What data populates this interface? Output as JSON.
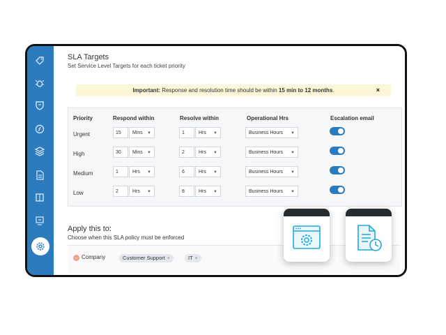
{
  "page": {
    "title": "SLA Targets",
    "subtitle": "Set Service Level Targets for each ticket priority"
  },
  "notice": {
    "label": "Important:",
    "text_before": " Response and resolution time should be within ",
    "range": "15 min to 12 months",
    "text_after": ".",
    "close": "×"
  },
  "table": {
    "headers": {
      "priority": "Priority",
      "respond": "Respond within",
      "resolve": "Resolve within",
      "operational": "Operational Hrs",
      "escalation": "Escalation email"
    },
    "rows": [
      {
        "priority": "Urgent",
        "respond_value": "15",
        "respond_unit": "Mins",
        "resolve_value": "1",
        "resolve_unit": "Hrs",
        "operational": "Business Hours",
        "escalation_on": true
      },
      {
        "priority": "High",
        "respond_value": "30",
        "respond_unit": "Mins",
        "resolve_value": "2",
        "resolve_unit": "Hrs",
        "operational": "Business Hours",
        "escalation_on": true
      },
      {
        "priority": "Medium",
        "respond_value": "1",
        "respond_unit": "Hrs",
        "resolve_value": "6",
        "resolve_unit": "Hrs",
        "operational": "Business Hours",
        "escalation_on": true
      },
      {
        "priority": "Low",
        "respond_value": "2",
        "respond_unit": "Hrs",
        "resolve_value": "8",
        "resolve_unit": "Hrs",
        "operational": "Business Hours",
        "escalation_on": true
      }
    ]
  },
  "apply": {
    "title": "Apply this to:",
    "subtitle": "Choose when this SLA policy must be enforced",
    "condition_label": "Company",
    "chips": [
      "Customer Support",
      "IT"
    ],
    "chip_remove": "×"
  },
  "sidebar": {
    "icons": [
      "tag-icon",
      "bug-icon",
      "shield-icon",
      "compass-icon",
      "layers-icon",
      "document-icon",
      "book-icon",
      "inbox-icon"
    ],
    "active": "settings-icon"
  },
  "cards": [
    "browser-settings-icon",
    "document-clock-icon"
  ],
  "colors": {
    "brand": "#2c7bbf",
    "notice_bg": "#fcf5d7",
    "card_accent": "#1fa7df"
  }
}
